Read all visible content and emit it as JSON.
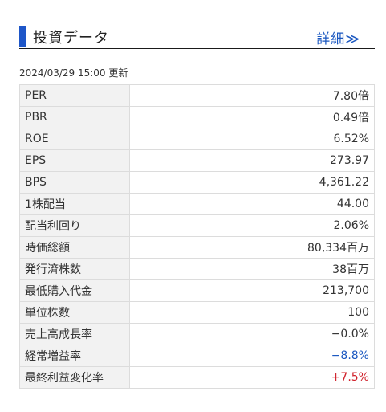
{
  "header": {
    "title": "投資データ",
    "more_label": "詳細≫"
  },
  "updated": "2024/03/29 15:00 更新",
  "rows": [
    {
      "label": "PER",
      "value": "7.80倍"
    },
    {
      "label": "PBR",
      "value": "0.49倍"
    },
    {
      "label": "ROE",
      "value": "6.52%"
    },
    {
      "label": "EPS",
      "value": "273.97"
    },
    {
      "label": "BPS",
      "value": "4,361.22"
    },
    {
      "label": "1株配当",
      "value": "44.00"
    },
    {
      "label": "配当利回り",
      "value": "2.06%"
    },
    {
      "label": "時価総額",
      "value": "80,334百万"
    },
    {
      "label": "発行済株数",
      "value": "38百万"
    },
    {
      "label": "最低購入代金",
      "value": "213,700"
    },
    {
      "label": "単位株数",
      "value": "100"
    },
    {
      "label": "売上高成長率",
      "value": "−0.0%"
    },
    {
      "label": "経常増益率",
      "value": "−8.8%"
    },
    {
      "label": "最終利益変化率",
      "value": "+7.5%"
    }
  ],
  "colors": {
    "accent": "#1e56c8",
    "negative": "#1a57c0",
    "positive": "#d0202a"
  }
}
